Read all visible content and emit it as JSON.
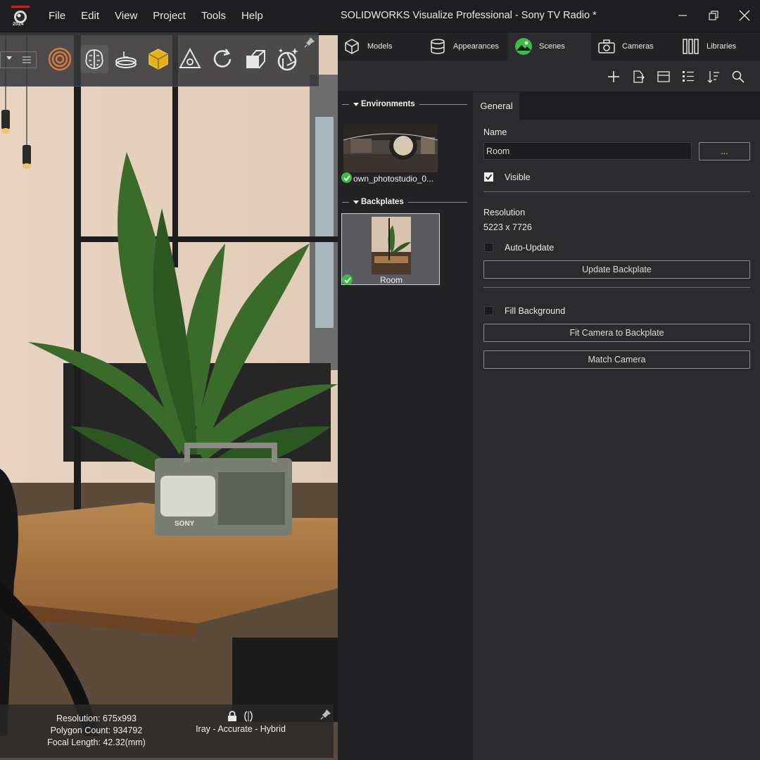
{
  "app": {
    "logo_year": "2024",
    "title": "SOLIDWORKS Visualize Professional - Sony TV Radio *",
    "menu": [
      "File",
      "Edit",
      "View",
      "Project",
      "Tools",
      "Help"
    ]
  },
  "viewport": {
    "tv_brand": "SONY",
    "status": {
      "resolution": "Resolution: 675x993",
      "polygon_count": "Polygon Count: 934792",
      "focal_length": "Focal Length: 42.32(mm)",
      "render_mode": "Iray - Accurate - Hybrid"
    }
  },
  "tabs": [
    {
      "label": "Models",
      "icon": "cube-icon"
    },
    {
      "label": "Appearances",
      "icon": "cylinder-icon"
    },
    {
      "label": "Scenes",
      "icon": "landscape-icon",
      "active": true
    },
    {
      "label": "Cameras",
      "icon": "camera-icon"
    },
    {
      "label": "Libraries",
      "icon": "books-icon"
    }
  ],
  "library": {
    "environments_header": "Environments",
    "environment_item": "own_photostudio_0...",
    "backplates_header": "Backplates",
    "backplate_item": "Room"
  },
  "properties": {
    "tab": "General",
    "name_label": "Name",
    "name_value": "Room",
    "browse_button": "...",
    "visible_label": "Visible",
    "visible_checked": true,
    "resolution_label": "Resolution",
    "resolution_value": "5223 x 7726",
    "auto_update_label": "Auto-Update",
    "auto_update_checked": false,
    "update_backplate_button": "Update Backplate",
    "fill_background_label": "Fill Background",
    "fill_background_checked": false,
    "fit_camera_button": "Fit Camera to Backplate",
    "match_camera_button": "Match Camera"
  },
  "colors": {
    "accent_green": "#3cba4a",
    "panel_bg": "#2b2b2d",
    "title_bg": "#1e1e20"
  }
}
